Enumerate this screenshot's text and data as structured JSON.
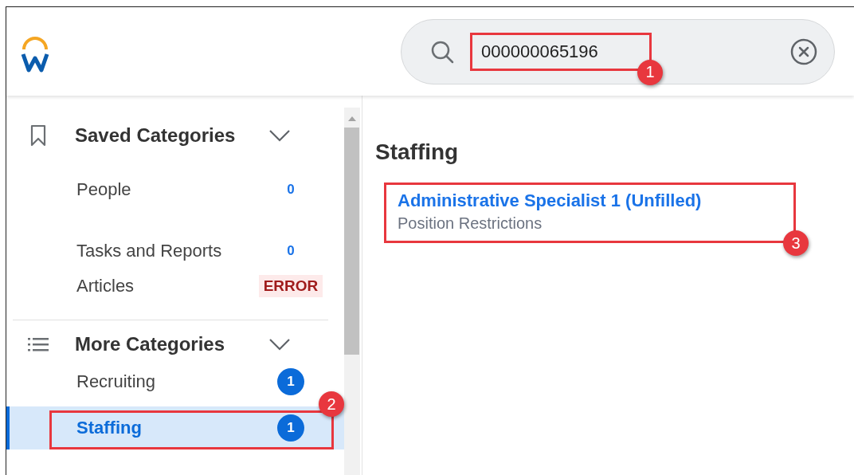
{
  "header": {
    "search": {
      "value": "000000065196",
      "callout": "1"
    }
  },
  "sidebar": {
    "sections": [
      {
        "title": "Saved Categories",
        "kind": "saved",
        "expanded": true,
        "items": [
          {
            "label": "People",
            "count": "0",
            "kind": "count",
            "selected": false
          },
          {
            "label": "Tasks and Reports",
            "count": "0",
            "kind": "count",
            "selected": false
          },
          {
            "label": "Articles",
            "count": "ERROR",
            "kind": "error",
            "selected": false
          }
        ]
      },
      {
        "title": "More Categories",
        "kind": "more",
        "expanded": true,
        "items": [
          {
            "label": "Recruiting",
            "count": "1",
            "kind": "badge",
            "selected": false
          },
          {
            "label": "Staffing",
            "count": "1",
            "kind": "badge",
            "selected": true,
            "callout": "2"
          }
        ]
      }
    ]
  },
  "main": {
    "heading": "Staffing",
    "results": [
      {
        "title": "Administrative Specialist 1 (Unfilled)",
        "subtitle": "Position Restrictions",
        "callout": "3"
      }
    ]
  }
}
